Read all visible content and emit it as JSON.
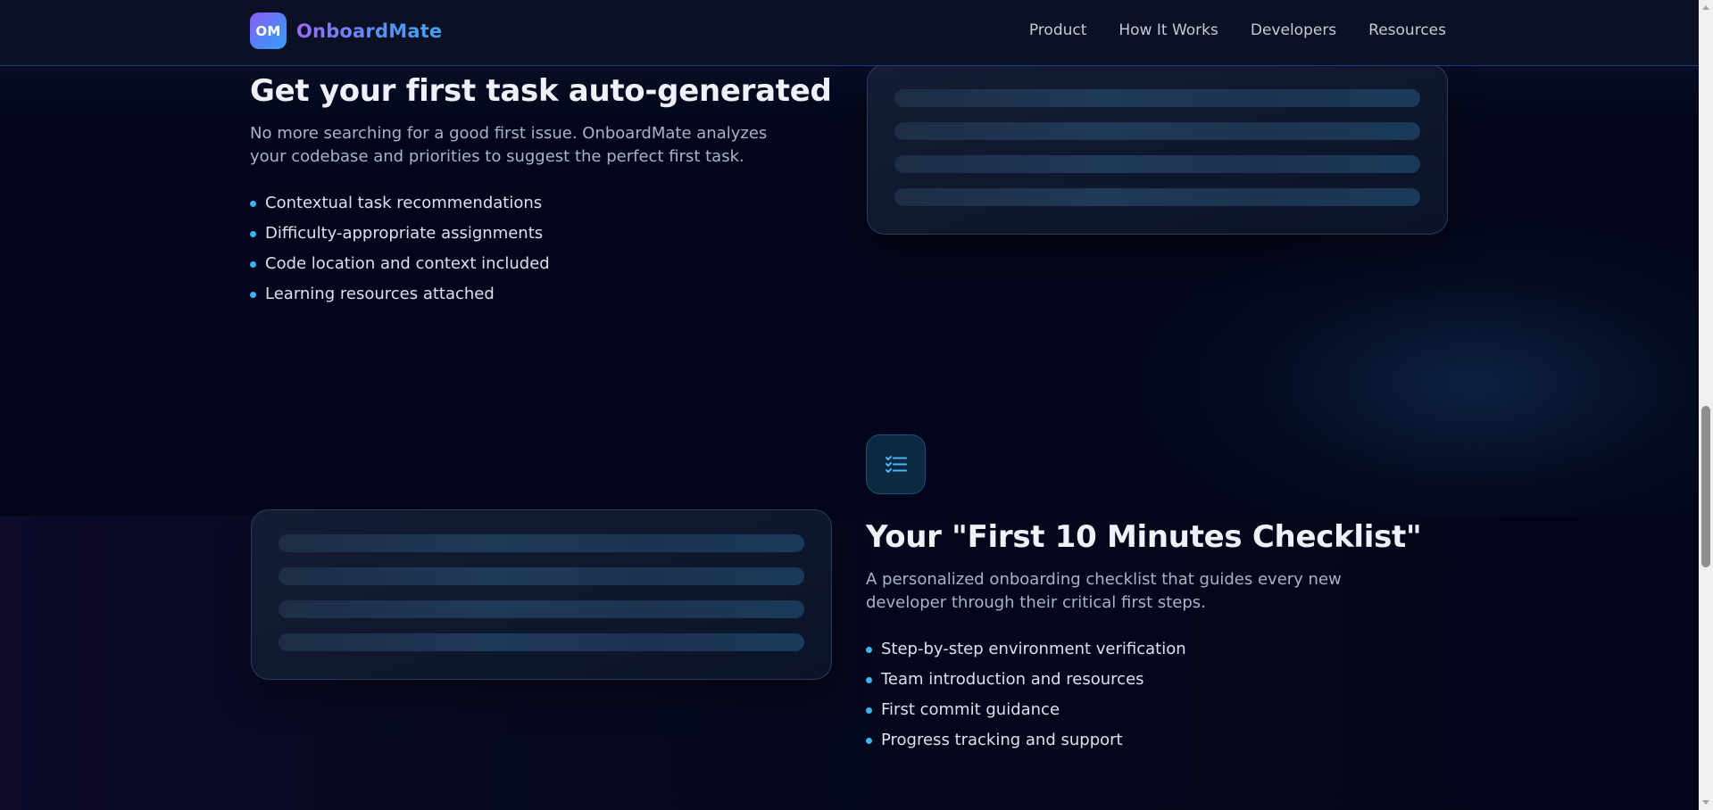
{
  "header": {
    "logo_mark": "OM",
    "logo_text": "OnboardMate",
    "nav": [
      {
        "label": "Product"
      },
      {
        "label": "How It Works"
      },
      {
        "label": "Developers"
      },
      {
        "label": "Resources"
      }
    ]
  },
  "features": [
    {
      "title": "Get your first task auto-generated",
      "description": "No more searching for a good first issue. OnboardMate analyzes your codebase and priorities to suggest the perfect first task.",
      "bullets": [
        "Contextual task recommendations",
        "Difficulty-appropriate assignments",
        "Code location and context included",
        "Learning resources attached"
      ]
    },
    {
      "icon": "checklist-icon",
      "title": "Your \"First 10 Minutes Checklist\"",
      "description": "A personalized onboarding checklist that guides every new developer through their critical first steps.",
      "bullets": [
        "Step-by-step environment verification",
        "Team introduction and resources",
        "First commit guidance",
        "Progress tracking and support"
      ]
    }
  ],
  "colors": {
    "background": "#03061a",
    "accent": "#3ab4f2",
    "brand_purple": "#8c5cf6",
    "brand_blue": "#4f86f7"
  }
}
